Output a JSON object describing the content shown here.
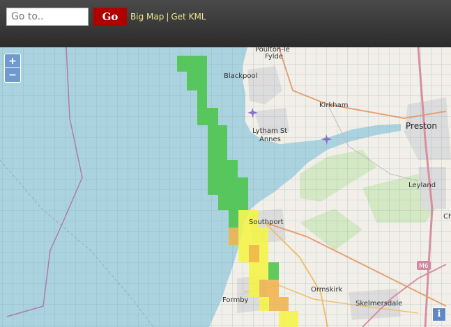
{
  "topbar": {
    "search_placeholder": "Go to..",
    "go_label": "Go",
    "big_map_label": "Big Map",
    "separator": "|",
    "kml_label": "Get KML"
  },
  "map": {
    "places": {
      "fylde": "Fylde",
      "blackpool": "Blackpool",
      "kirkham": "Kirkham",
      "preston": "Preston",
      "lytham": "Lytham St",
      "annes": "Annes",
      "leyland": "Leyland",
      "southport": "Southport",
      "chorley_partial": "Ch",
      "ormskirk": "Ormskirk",
      "formby": "Formby",
      "skelmersdale": "Skelmersdale",
      "motorway": "M6",
      "top_cut": "Poulton-le"
    },
    "legend_colors": {
      "sea": "#aad3df",
      "land": "#f2efe9",
      "green": "#4fc64f",
      "yellow": "#f5f542",
      "orange": "#f0b34a"
    }
  },
  "controls": {
    "zoom_in": "+",
    "zoom_out": "−",
    "info": "i"
  }
}
